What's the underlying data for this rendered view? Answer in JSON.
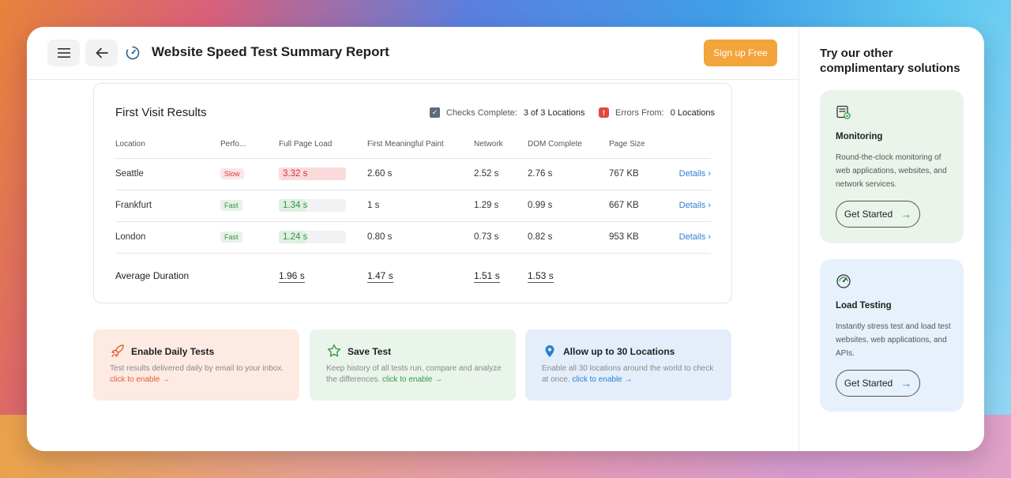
{
  "header": {
    "title": "Website Speed Test Summary Report",
    "signup_label": "Sign up Free"
  },
  "results": {
    "title": "First Visit Results",
    "checks_label": "Checks Complete:",
    "checks_value": "3 of 3 Locations",
    "errors_label": "Errors From:",
    "errors_value": "0 Locations",
    "columns": [
      "Location",
      "Perfo...",
      "Full Page Load",
      "First Meaningful Paint",
      "Network",
      "DOM Complete",
      "Page Size"
    ],
    "rows": [
      {
        "location": "Seattle",
        "perf": "Slow",
        "full_page_load": "3.32 s",
        "fmp": "2.60 s",
        "network": "2.52 s",
        "dom": "2.76 s",
        "size": "767 KB",
        "details": "Details ›"
      },
      {
        "location": "Frankfurt",
        "perf": "Fast",
        "full_page_load": "1.34 s",
        "fmp": "1 s",
        "network": "1.29 s",
        "dom": "0.99 s",
        "size": "667 KB",
        "details": "Details ›"
      },
      {
        "location": "London",
        "perf": "Fast",
        "full_page_load": "1.24 s",
        "fmp": "0.80 s",
        "network": "0.73 s",
        "dom": "0.82 s",
        "size": "953 KB",
        "details": "Details ›"
      }
    ],
    "average": {
      "label": "Average Duration",
      "full_page_load": "1.96 s",
      "fmp": "1.47 s",
      "network": "1.51 s",
      "dom": "1.53 s"
    }
  },
  "features": [
    {
      "title": "Enable Daily Tests",
      "desc": "Test results delivered daily by email to your inbox.",
      "link": "click to enable →",
      "icon": "rocket-icon",
      "color": "#e0613b"
    },
    {
      "title": "Save Test",
      "desc": "Keep history of all tests run, compare and analyze the differences.",
      "link": "click to enable →",
      "icon": "star-icon",
      "color": "#3a9a4a"
    },
    {
      "title": "Allow up to 30 Locations",
      "desc": "Enable all 30 locations around the world to check at once.",
      "link": "click to enable →",
      "icon": "location-pin-icon",
      "color": "#2d7fd3"
    }
  ],
  "sidebar": {
    "title": "Try our other complimentary solutions",
    "solutions": [
      {
        "title": "Monitoring",
        "desc": "Round-the-clock monitoring of web applications, websites, and network services.",
        "cta": "Get Started",
        "icon": "monitoring-icon"
      },
      {
        "title": "Load Testing",
        "desc": "Instantly stress test and load test websites, web applications, and APIs.",
        "cta": "Get Started",
        "icon": "speedometer-icon"
      }
    ]
  },
  "colors": {
    "accent_orange": "#f3a43a",
    "slow_red": "#d63b3b",
    "fast_green": "#3a8f45",
    "link_blue": "#2d7fd3"
  }
}
